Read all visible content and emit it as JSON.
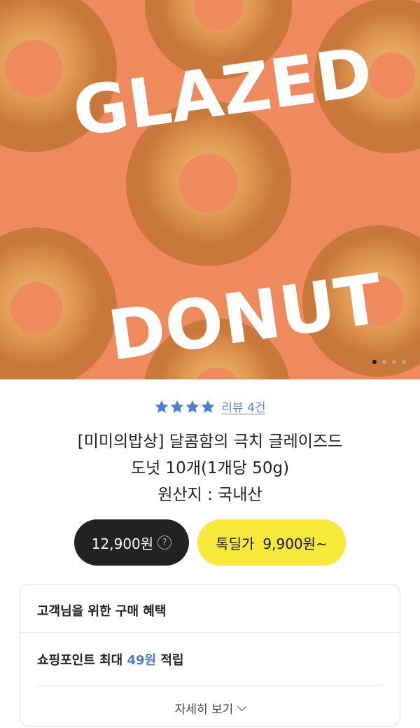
{
  "hero": {
    "headline_top": "GLAZED",
    "headline_bottom": "DONUT",
    "bg_color": "#ee8a5e",
    "slide_count": 4,
    "active_slide": 1
  },
  "rating": {
    "stars": 4,
    "star_color": "#4d7fd1",
    "review_label": "리뷰 4건"
  },
  "product": {
    "title_line1": "[미미의밥상] 달콤함의 극치 글레이즈드",
    "title_line2": "도넛 10개(1개당 50g)",
    "origin": "원산지 : 국내산"
  },
  "pricing": {
    "original_price": "12,900원",
    "help_icon": "?",
    "deal_label": "톡딜가",
    "deal_price": "9,900원~"
  },
  "benefits": {
    "header": "고객님을 위한 구매 혜택",
    "points_prefix": "쇼핑포인트 최대",
    "points_value": "49원",
    "points_suffix": "적립",
    "more_label": "자세히 보기"
  }
}
